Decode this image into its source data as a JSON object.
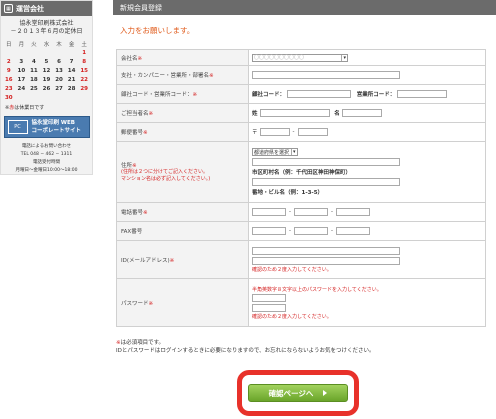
{
  "sidebar": {
    "header": "運営会社",
    "company": "協永堂印刷株式会社",
    "cal_title": "－２０１３年６月の定休日",
    "dow": [
      "日",
      "月",
      "火",
      "水",
      "木",
      "金",
      "土"
    ],
    "weeks": [
      [
        {
          "d": "",
          "r": false
        },
        {
          "d": "",
          "r": false
        },
        {
          "d": "",
          "r": false
        },
        {
          "d": "",
          "r": false
        },
        {
          "d": "",
          "r": false
        },
        {
          "d": "",
          "r": false
        },
        {
          "d": "1",
          "r": true
        }
      ],
      [
        {
          "d": "2",
          "r": true
        },
        {
          "d": "3",
          "r": false
        },
        {
          "d": "4",
          "r": false
        },
        {
          "d": "5",
          "r": false
        },
        {
          "d": "6",
          "r": false
        },
        {
          "d": "7",
          "r": false
        },
        {
          "d": "8",
          "r": true
        }
      ],
      [
        {
          "d": "9",
          "r": true
        },
        {
          "d": "10",
          "r": false
        },
        {
          "d": "11",
          "r": false
        },
        {
          "d": "12",
          "r": false
        },
        {
          "d": "13",
          "r": false
        },
        {
          "d": "14",
          "r": false
        },
        {
          "d": "15",
          "r": true
        }
      ],
      [
        {
          "d": "16",
          "r": true
        },
        {
          "d": "17",
          "r": false
        },
        {
          "d": "18",
          "r": false
        },
        {
          "d": "19",
          "r": false
        },
        {
          "d": "20",
          "r": false
        },
        {
          "d": "21",
          "r": false
        },
        {
          "d": "22",
          "r": true
        }
      ],
      [
        {
          "d": "23",
          "r": true
        },
        {
          "d": "24",
          "r": false
        },
        {
          "d": "25",
          "r": false
        },
        {
          "d": "26",
          "r": false
        },
        {
          "d": "27",
          "r": false
        },
        {
          "d": "28",
          "r": false
        },
        {
          "d": "29",
          "r": true
        }
      ],
      [
        {
          "d": "30",
          "r": true
        },
        {
          "d": "",
          "r": false
        },
        {
          "d": "",
          "r": false
        },
        {
          "d": "",
          "r": false
        },
        {
          "d": "",
          "r": false
        },
        {
          "d": "",
          "r": false
        },
        {
          "d": "",
          "r": false
        }
      ]
    ],
    "cal_note_mark": "※",
    "cal_note_red": "赤",
    "cal_note_text": "は休業日です",
    "banner_pc": "PC",
    "banner_line1": "協永堂印刷 WEB",
    "banner_line2": "コーポレートサイト",
    "contact_line1": "電話によるお問い合わせ",
    "contact_line2": "TEL 048 − 462 − 1311",
    "contact_line3": "電話受付時間",
    "contact_line4": "月曜日～金曜日10:00～18:00"
  },
  "main": {
    "header": "新規会員登録",
    "intro": "入力をお願いします。"
  },
  "form": {
    "req_mark": "※",
    "company_label": "会社名",
    "company_value": "〇〇〇〇〇〇〇〇〇〇",
    "branch_label": "支社・カンパニー・営業所・部署名",
    "sales_code_label": "顧社コード・営業所コード：",
    "sales_code_sub1": "顧社コード：",
    "sales_code_sub2": "営業所コード：",
    "person_label": "ご担当者名",
    "last_name_sub": "姓",
    "first_name_sub": "名",
    "postal_label": "郵便番号",
    "postal_mark": "〒",
    "address_label": "住所",
    "address_hint1": "(住所は２つに分けてご記入ください。",
    "address_hint2": "マンション名は必ず記入してください。)",
    "pref_select": "都道府県を選択",
    "city_label": "市区町村名（例：千代田区神田神保町）",
    "street_label": "番地・ビル名（例：1-3-5）",
    "tel_label": "電話番号",
    "fax_label": "FAX番号",
    "id_label": "ID(メールアドレス)",
    "id_confirm_note": "確認のため２度入力してください。",
    "pw_label": "パスワード",
    "pw_note1": "半角英数字８文字以上のパスワードを入力してください。",
    "pw_note2": "確認のため２度入力してください。"
  },
  "footnotes": {
    "req_mark": "※",
    "line1": "は必須項目です。",
    "line2": "IDとパスワードはログインするときに必要になりますので、お忘れにならないようお気をつけください。"
  },
  "confirm_button": "確認ページへ",
  "colors": {
    "header_bg": "#6b6b6b",
    "required": "#d42020",
    "intro": "#e05a1a",
    "button": "#7fb83a",
    "highlight": "#e8312a"
  }
}
